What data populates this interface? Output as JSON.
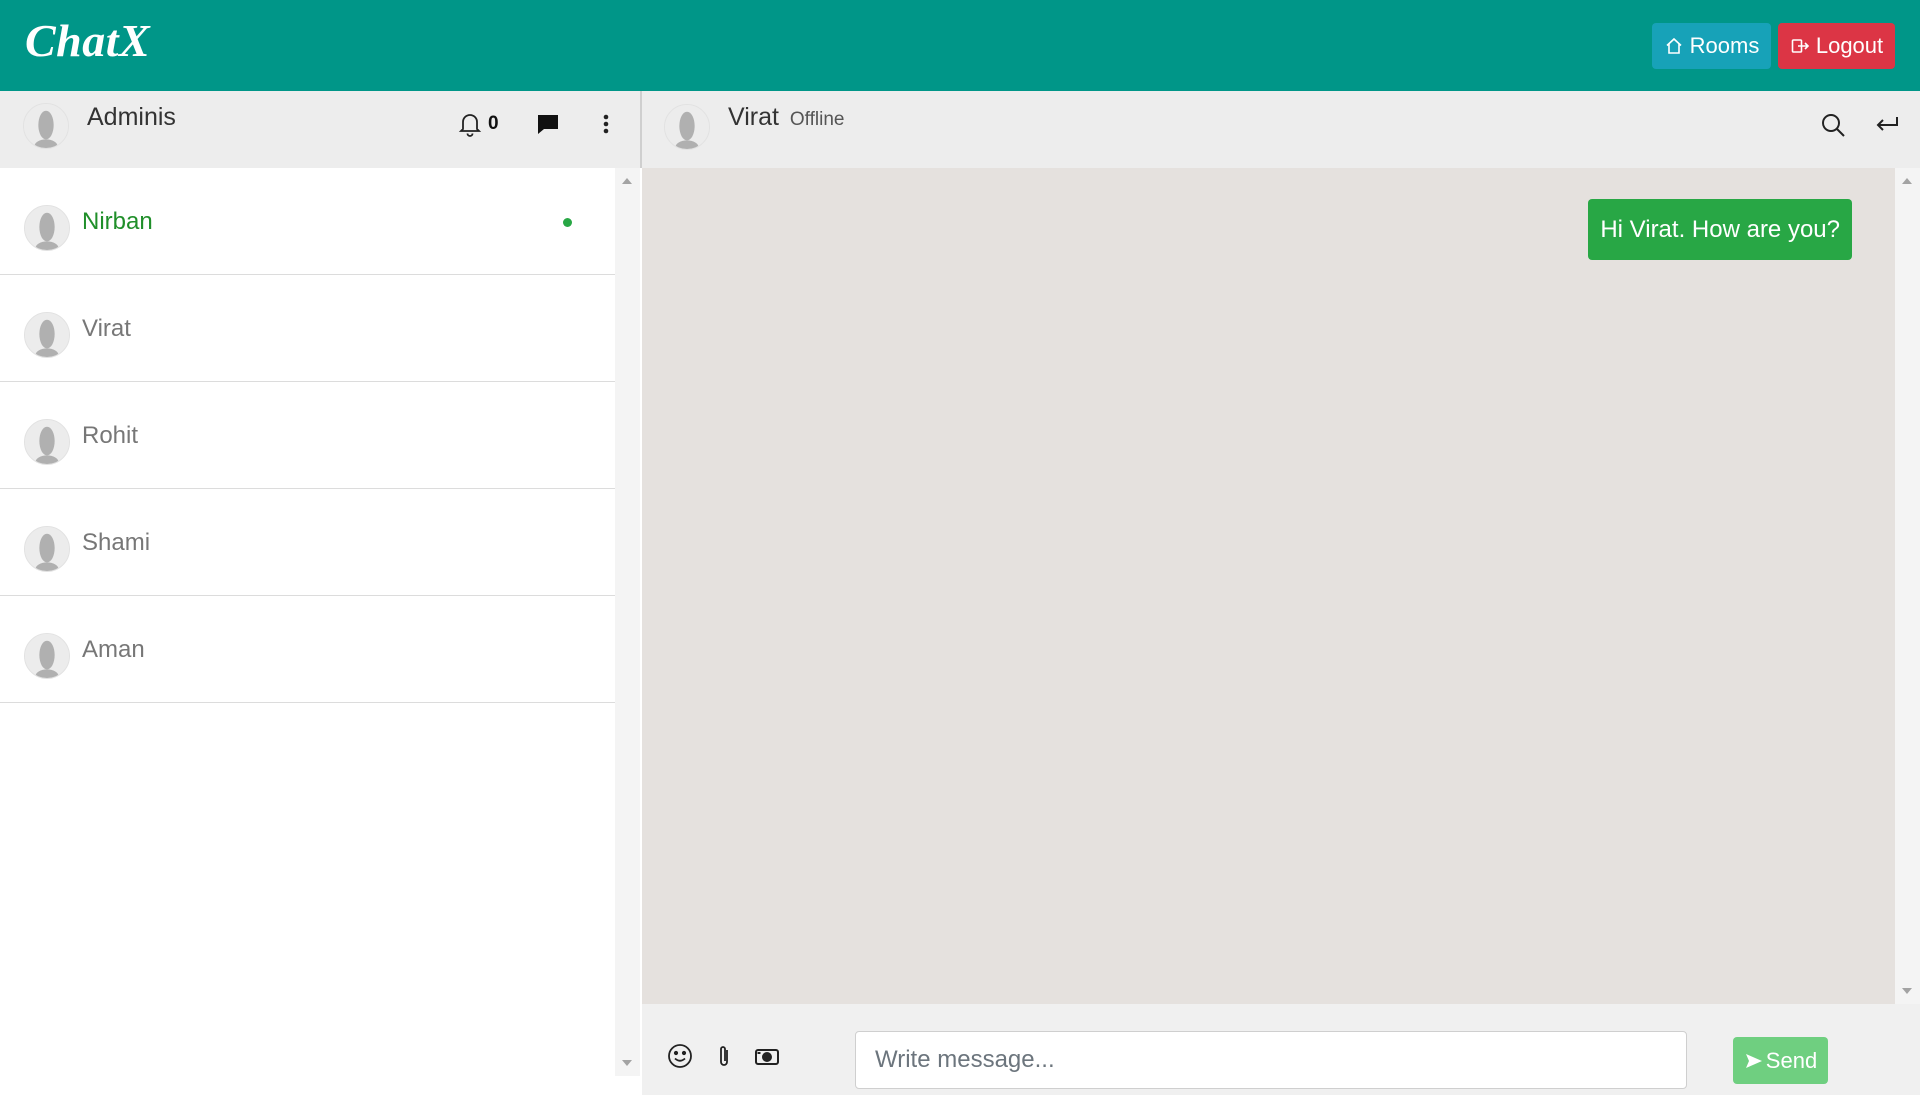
{
  "app": {
    "brand": "ChatX"
  },
  "navbar": {
    "rooms_label": "Rooms",
    "logout_label": "Logout"
  },
  "colors": {
    "navbar": "#009688",
    "rooms": "#17a2b8",
    "logout": "#dc3545",
    "online": "#28a745",
    "bubble": "#28a745",
    "chat_bg": "#e5e1de"
  },
  "sidebar": {
    "user_name": "Adminis",
    "notification_count": "0",
    "icons": [
      "bell-icon",
      "chat-icon",
      "kebab-menu-icon"
    ],
    "contacts": [
      {
        "name": "Nirban",
        "active": true,
        "online": true
      },
      {
        "name": "Virat",
        "active": false,
        "online": false
      },
      {
        "name": "Rohit",
        "active": false,
        "online": false
      },
      {
        "name": "Shami",
        "active": false,
        "online": false
      },
      {
        "name": "Aman",
        "active": false,
        "online": false
      }
    ]
  },
  "chat": {
    "contact_name": "Virat",
    "status": "Offline",
    "messages": [
      {
        "text": "Hi Virat. How are you?",
        "direction": "outgoing"
      }
    ],
    "input_placeholder": "Write message...",
    "input_value": "",
    "send_label": "Send",
    "tools": [
      "emoji-icon",
      "attach-icon",
      "camera-icon"
    ]
  }
}
